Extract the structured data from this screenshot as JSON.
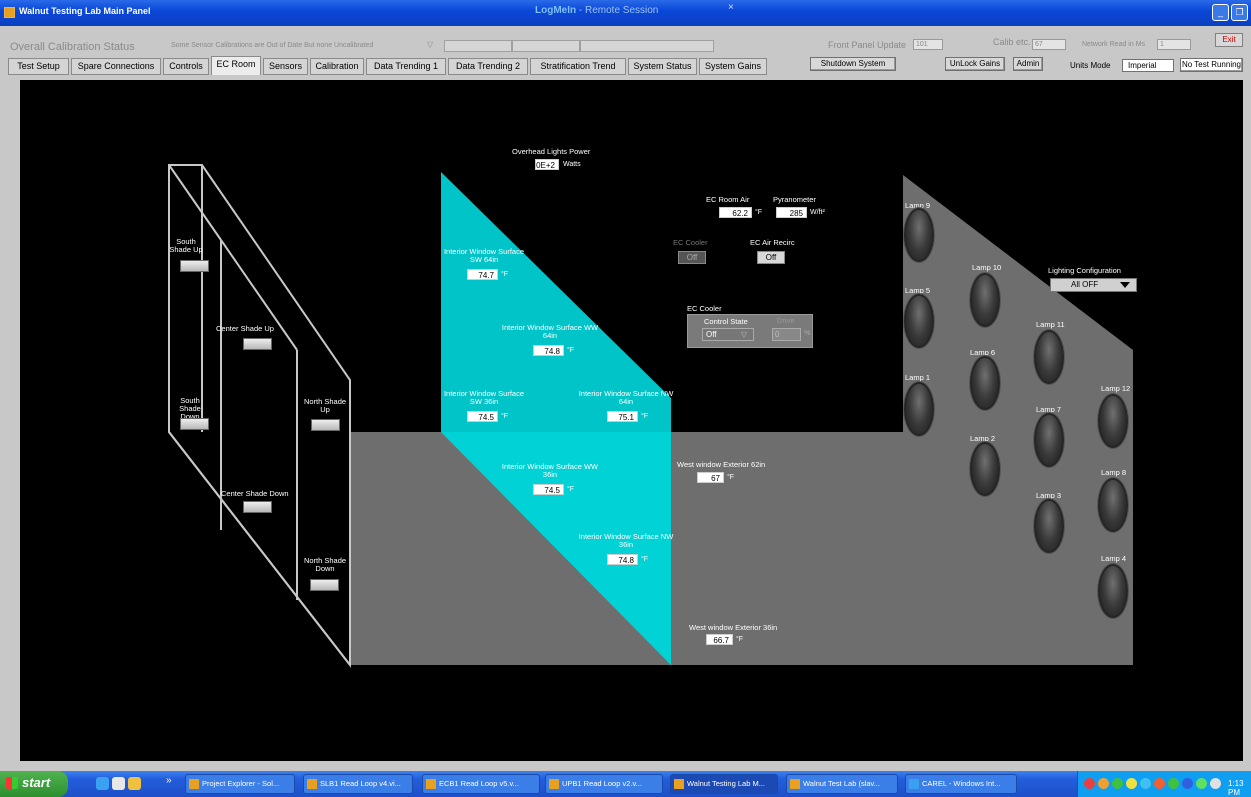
{
  "window": {
    "title": "Walnut Testing Lab Main Panel",
    "session_app": "LogMeIn",
    "session_label": "- Remote Session",
    "close_x": "×"
  },
  "header": {
    "overall_label": "Overall Calibration Status",
    "calibration_message": "Some Sensor Calibrations are Out of Date But none Uncalibrated",
    "front_panel_label": "Front Panel Update",
    "front_panel_value": "101",
    "calib_label": "Calib etc.",
    "calib_value": "67",
    "network_label": "Network Read in Ms",
    "network_value": "1",
    "exit_label": "Exit",
    "shutdown_label": "Shutdown System",
    "unlock_label": "UnLock Gains",
    "admin_label": "Admin",
    "units_label": "Units Mode",
    "units_value": "Imperial",
    "test_status": "No Test Running"
  },
  "tabs": [
    {
      "label": "Test Setup"
    },
    {
      "label": "Spare Connections"
    },
    {
      "label": "Controls"
    },
    {
      "label": "EC Room"
    },
    {
      "label": "Sensors"
    },
    {
      "label": "Calibration"
    },
    {
      "label": "Data Trending 1"
    },
    {
      "label": "Data Trending 2"
    },
    {
      "label": "Stratification Trend"
    },
    {
      "label": "System Status"
    },
    {
      "label": "System Gains"
    }
  ],
  "room": {
    "overhead_label": "Overhead Lights Power",
    "overhead_value": "0E+2",
    "overhead_unit": "Watts",
    "ec_air_label": "EC Room Air",
    "ec_air_value": "62.2",
    "ec_air_unit": "°F",
    "pyr_label": "Pyranometer",
    "pyr_value": "285",
    "pyr_unit": "W/ft²",
    "ec_cooler_label": "EC Cooler",
    "ec_cooler_state": "Off",
    "ec_air_recirc_label": "EC Air Recirc",
    "ec_air_recirc_state": "Off",
    "ec_cooler_group_label": "EC Cooler",
    "control_state_label": "Control State",
    "control_state_value": "Off",
    "drive_label": "Drive",
    "drive_value": "0",
    "drive_unit": "%",
    "shades": {
      "south_up": "South Shade Up",
      "center_up": "Center Shade Up",
      "south_down": "South Shade Down",
      "north_up": "North Shade Up",
      "center_down": "Center Shade Down",
      "north_down": "North Shade Down"
    },
    "sensors": {
      "sw64_label": "Interior Window Surface SW 64in",
      "sw64_value": "74.7",
      "ww64_label": "Interior Window Surface WW 64in",
      "ww64_value": "74.8",
      "sw36_label": "Interior Window Surface SW 36in",
      "sw36_value": "74.5",
      "nw64_label": "Interior Window Surface NW 64in",
      "nw64_value": "75.1",
      "ww36_label": "Interior Window Surface WW 36in",
      "ww36_value": "74.5",
      "nw36_label": "Interior Window Surface NW 36in",
      "nw36_value": "74.8",
      "west62_label": "West window Exterior 62in",
      "west62_value": "67",
      "west36_label": "West window Exterior  36in",
      "west36_value": "66.7",
      "temp_unit": "°F"
    },
    "lighting_config_label": "Lighting Configuration",
    "lighting_config_value": "All OFF",
    "lamps": [
      "Lamp 9",
      "Lamp 10",
      "Lamp 5",
      "Lamp 11",
      "Lamp 6",
      "Lamp 1",
      "Lamp 12",
      "Lamp 7",
      "Lamp 2",
      "Lamp 8",
      "Lamp 3",
      "Lamp 4"
    ]
  },
  "taskbar": {
    "start": "start",
    "chevron": "»",
    "items": [
      "Project Explorer - Sol...",
      "SLB1 Read Loop v4.vi...",
      "ECB1 Read Loop v5.v...",
      "UPB1 Read Loop v2.v...",
      "Walnut Testing Lab M...",
      "Walnut Test Lab (slav...",
      "CAREL - Windows Int..."
    ],
    "clock": "1:13 PM"
  },
  "colors": {
    "cyan": "#00c4c8",
    "dark_cyan": "#00a8ac",
    "floor": "#6e6e6e"
  }
}
